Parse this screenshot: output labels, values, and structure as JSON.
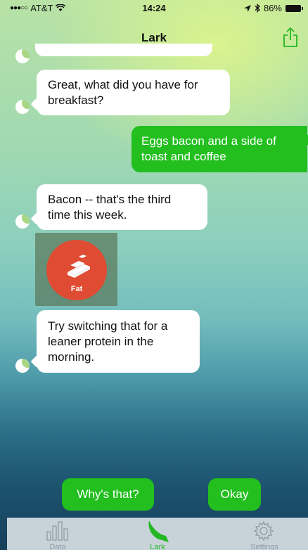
{
  "status_bar": {
    "carrier": "AT&T",
    "time": "14:24",
    "battery": "86%"
  },
  "nav": {
    "title": "Lark"
  },
  "messages": [
    {
      "from": "bot",
      "text": "Great, what did you have for breakfast?"
    },
    {
      "from": "user",
      "text": "Eggs bacon and a side of toast and coffee"
    },
    {
      "from": "bot",
      "text": "Bacon -- that's the third time this week."
    },
    {
      "from": "bot",
      "type": "card",
      "label": "Fat"
    },
    {
      "from": "bot",
      "text": "Try switching that for a leaner protein in the morning."
    }
  ],
  "quick_replies": [
    {
      "label": "Why's that?"
    },
    {
      "label": "Okay"
    }
  ],
  "tabs": [
    {
      "label": "Data",
      "icon": "bar-chart-icon"
    },
    {
      "label": "Lark",
      "icon": "bird-icon",
      "active": true
    },
    {
      "label": "Settings",
      "icon": "gear-icon"
    }
  ],
  "colors": {
    "accent": "#22bf1f",
    "bubble_in": "#ffffff",
    "fat_badge": "#e04b33",
    "tab_bar": "#c7d3d9"
  }
}
